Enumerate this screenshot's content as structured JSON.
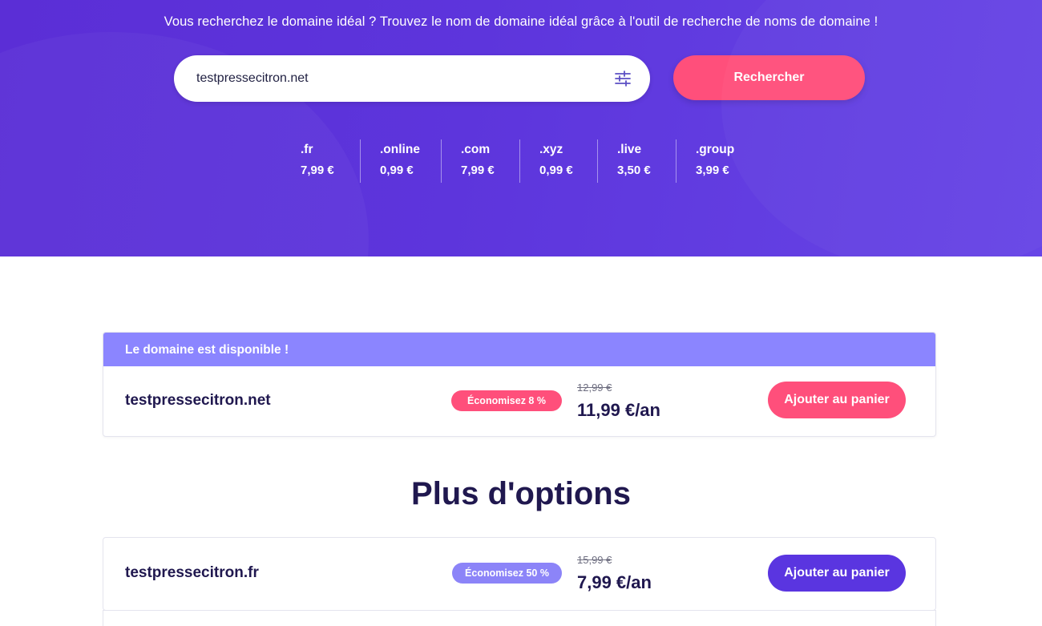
{
  "hero": {
    "tagline": "Vous recherchez le domaine idéal ? Trouvez le nom de domaine idéal grâce à l'outil de recherche de noms de domaine !",
    "search": {
      "value": "testpressecitron.net",
      "filter_icon": "sliders-icon"
    },
    "search_button": "Rechercher",
    "tlds": [
      {
        "name": ".fr",
        "price": "7,99 €"
      },
      {
        "name": ".online",
        "price": "0,99 €"
      },
      {
        "name": ".com",
        "price": "7,99 €"
      },
      {
        "name": ".xyz",
        "price": "0,99 €"
      },
      {
        "name": ".live",
        "price": "3,50 €"
      },
      {
        "name": ".group",
        "price": "3,99 €"
      }
    ]
  },
  "result": {
    "header": "Le domaine est disponible !",
    "domain": "testpressecitron.net",
    "badge": "Économisez 8 %",
    "old_price": "12,99 €",
    "price": "11,99 €/an",
    "button": "Ajouter au panier"
  },
  "more_options": {
    "title": "Plus d'options",
    "items": [
      {
        "domain": "testpressecitron.fr",
        "badge": "Économisez 50 %",
        "old_price": "15,99 €",
        "price": "7,99 €/an",
        "button": "Ajouter au panier"
      }
    ]
  },
  "colors": {
    "hero_bg": "#5b2ed6",
    "accent_pink": "#ff4f7b",
    "accent_purple": "#5a35e0",
    "header_lavender": "#8b85ff",
    "badge_lavender": "#8c84f8",
    "text_dark": "#20184f"
  }
}
